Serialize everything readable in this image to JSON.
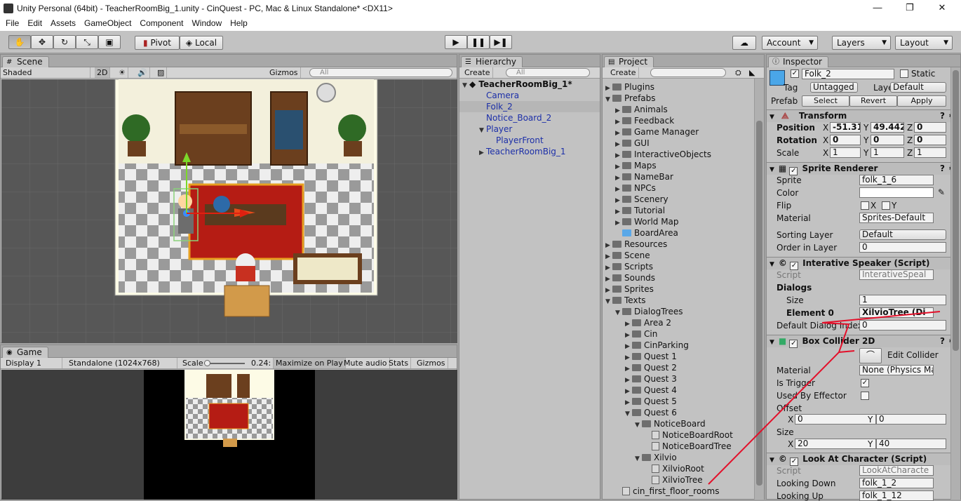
{
  "window": {
    "title": "Unity Personal (64bit) - TeacherRoomBig_1.unity - CinQuest - PC, Mac & Linux Standalone* <DX11>",
    "minimize": "—",
    "maximize": "❐",
    "close": "✕"
  },
  "menu": [
    "File",
    "Edit",
    "Assets",
    "GameObject",
    "Component",
    "Window",
    "Help"
  ],
  "toolbar": {
    "pivot": "Pivot",
    "local": "Local",
    "account": "Account",
    "layers": "Layers",
    "layout": "Layout",
    "play_icon": "play-icon",
    "pause_icon": "pause-icon",
    "step_icon": "step-icon",
    "cloud_icon": "cloud-icon"
  },
  "scene": {
    "tab": "Scene",
    "shading": "Shaded",
    "mode2d": "2D",
    "gizmos": "Gizmos",
    "search_placeholder": "All"
  },
  "game": {
    "tab": "Game",
    "display": "Display 1",
    "resolution": "Standalone (1024x768)",
    "scale_label": "Scale",
    "scale_value": "0.24:",
    "maximize": "Maximize on Play",
    "mute": "Mute audio",
    "stats": "Stats",
    "gizmos": "Gizmos"
  },
  "hierarchy": {
    "tab": "Hierarchy",
    "create": "Create",
    "search_placeholder": "All",
    "scene_name": "TeacherRoomBig_1*",
    "items": [
      {
        "label": "Camera",
        "depth": 1,
        "arrow": "",
        "selected": false
      },
      {
        "label": "Folk_2",
        "depth": 1,
        "arrow": "",
        "selected": true
      },
      {
        "label": "Notice_Board_2",
        "depth": 1,
        "arrow": "",
        "selected": false
      },
      {
        "label": "Player",
        "depth": 1,
        "arrow": "▼",
        "selected": false
      },
      {
        "label": "PlayerFront",
        "depth": 2,
        "arrow": "",
        "selected": false
      },
      {
        "label": "TeacherRoomBig_1",
        "depth": 1,
        "arrow": "▶",
        "selected": false
      }
    ]
  },
  "project": {
    "tab": "Project",
    "create": "Create",
    "items": [
      {
        "label": "Plugins",
        "depth": 0,
        "arrow": "▶",
        "kind": "folder"
      },
      {
        "label": "Prefabs",
        "depth": 0,
        "arrow": "▼",
        "kind": "folder"
      },
      {
        "label": "Animals",
        "depth": 1,
        "arrow": "▶",
        "kind": "folder"
      },
      {
        "label": "Feedback",
        "depth": 1,
        "arrow": "▶",
        "kind": "folder"
      },
      {
        "label": "Game Manager",
        "depth": 1,
        "arrow": "▶",
        "kind": "folder"
      },
      {
        "label": "GUI",
        "depth": 1,
        "arrow": "▶",
        "kind": "folder"
      },
      {
        "label": "InteractiveObjects",
        "depth": 1,
        "arrow": "▶",
        "kind": "folder"
      },
      {
        "label": "Maps",
        "depth": 1,
        "arrow": "▶",
        "kind": "folder"
      },
      {
        "label": "NameBar",
        "depth": 1,
        "arrow": "▶",
        "kind": "folder"
      },
      {
        "label": "NPCs",
        "depth": 1,
        "arrow": "▶",
        "kind": "folder"
      },
      {
        "label": "Scenery",
        "depth": 1,
        "arrow": "▶",
        "kind": "folder"
      },
      {
        "label": "Tutorial",
        "depth": 1,
        "arrow": "▶",
        "kind": "folder"
      },
      {
        "label": "World Map",
        "depth": 1,
        "arrow": "▶",
        "kind": "folder"
      },
      {
        "label": "BoardArea",
        "depth": 1,
        "arrow": "",
        "kind": "prefab"
      },
      {
        "label": "Resources",
        "depth": 0,
        "arrow": "▶",
        "kind": "folder"
      },
      {
        "label": "Scene",
        "depth": 0,
        "arrow": "▶",
        "kind": "folder"
      },
      {
        "label": "Scripts",
        "depth": 0,
        "arrow": "▶",
        "kind": "folder"
      },
      {
        "label": "Sounds",
        "depth": 0,
        "arrow": "▶",
        "kind": "folder"
      },
      {
        "label": "Sprites",
        "depth": 0,
        "arrow": "▶",
        "kind": "folder"
      },
      {
        "label": "Texts",
        "depth": 0,
        "arrow": "▼",
        "kind": "folder"
      },
      {
        "label": "DialogTrees",
        "depth": 1,
        "arrow": "▼",
        "kind": "folder"
      },
      {
        "label": "Area 2",
        "depth": 2,
        "arrow": "▶",
        "kind": "folder"
      },
      {
        "label": "Cin",
        "depth": 2,
        "arrow": "▶",
        "kind": "folder"
      },
      {
        "label": "CinParking",
        "depth": 2,
        "arrow": "▶",
        "kind": "folder"
      },
      {
        "label": "Quest 1",
        "depth": 2,
        "arrow": "▶",
        "kind": "folder"
      },
      {
        "label": "Quest 2",
        "depth": 2,
        "arrow": "▶",
        "kind": "folder"
      },
      {
        "label": "Quest 3",
        "depth": 2,
        "arrow": "▶",
        "kind": "folder"
      },
      {
        "label": "Quest 4",
        "depth": 2,
        "arrow": "▶",
        "kind": "folder"
      },
      {
        "label": "Quest 5",
        "depth": 2,
        "arrow": "▶",
        "kind": "folder"
      },
      {
        "label": "Quest 6",
        "depth": 2,
        "arrow": "▼",
        "kind": "folder"
      },
      {
        "label": "NoticeBoard",
        "depth": 3,
        "arrow": "▼",
        "kind": "folder"
      },
      {
        "label": "NoticeBoardRoot",
        "depth": 4,
        "arrow": "",
        "kind": "file"
      },
      {
        "label": "NoticeBoardTree",
        "depth": 4,
        "arrow": "",
        "kind": "file"
      },
      {
        "label": "Xilvio",
        "depth": 3,
        "arrow": "▼",
        "kind": "folder"
      },
      {
        "label": "XilvioRoot",
        "depth": 4,
        "arrow": "",
        "kind": "file"
      },
      {
        "label": "XilvioTree",
        "depth": 4,
        "arrow": "",
        "kind": "file"
      },
      {
        "label": "cin_first_floor_rooms",
        "depth": 1,
        "arrow": "",
        "kind": "file"
      }
    ]
  },
  "inspector": {
    "tab": "Inspector",
    "name": "Folk_2",
    "static": "Static",
    "tag_label": "Tag",
    "tag": "Untagged",
    "layer_label": "Layer",
    "layer": "Default",
    "prefab_label": "Prefab",
    "select": "Select",
    "revert": "Revert",
    "apply": "Apply",
    "transform": {
      "title": "Transform",
      "position": "Position",
      "rotation": "Rotation",
      "scale": "Scale",
      "px": "-51.31",
      "py": "49.442",
      "pz": "0",
      "rx": "0",
      "ry": "0",
      "rz": "0",
      "sx": "1",
      "sy": "1",
      "sz": "1",
      "x": "X",
      "y": "Y",
      "z": "Z"
    },
    "sprite_renderer": {
      "title": "Sprite Renderer",
      "sprite_label": "Sprite",
      "sprite": "folk_1_6",
      "color_label": "Color",
      "flip_label": "Flip",
      "flip_x": "X",
      "flip_y": "Y",
      "material_label": "Material",
      "material": "Sprites-Default",
      "sorting_label": "Sorting Layer",
      "sorting": "Default",
      "order_label": "Order in Layer",
      "order": "0"
    },
    "speaker": {
      "title": "Interative Speaker (Script)",
      "script_label": "Script",
      "script": "InterativeSpeal",
      "dialogs": "Dialogs",
      "size_label": "Size",
      "size": "1",
      "element_label": "Element 0",
      "element": "XilvioTree (Di",
      "default_label": "Default Dialog Index",
      "default": "0"
    },
    "collider": {
      "title": "Box Collider 2D",
      "edit": "Edit Collider",
      "material_label": "Material",
      "material": "None (Physics Ma",
      "trigger_label": "Is Trigger",
      "effector_label": "Used By Effector",
      "offset_label": "Offset",
      "ox": "0",
      "oy": "0",
      "size_label": "Size",
      "sx": "20",
      "sy": "40",
      "x": "X",
      "y": "Y"
    },
    "look": {
      "title": "Look At Character (Script)",
      "script_label": "Script",
      "script": "LookAtCharacte",
      "down_label": "Looking Down",
      "down": "folk_1_2",
      "up_label": "Looking Up",
      "up": "folk_1_12"
    }
  },
  "colors": {
    "selection": "#8aa6d8",
    "annotation": "#e3102a",
    "text_blue": "#1c2fa8"
  }
}
